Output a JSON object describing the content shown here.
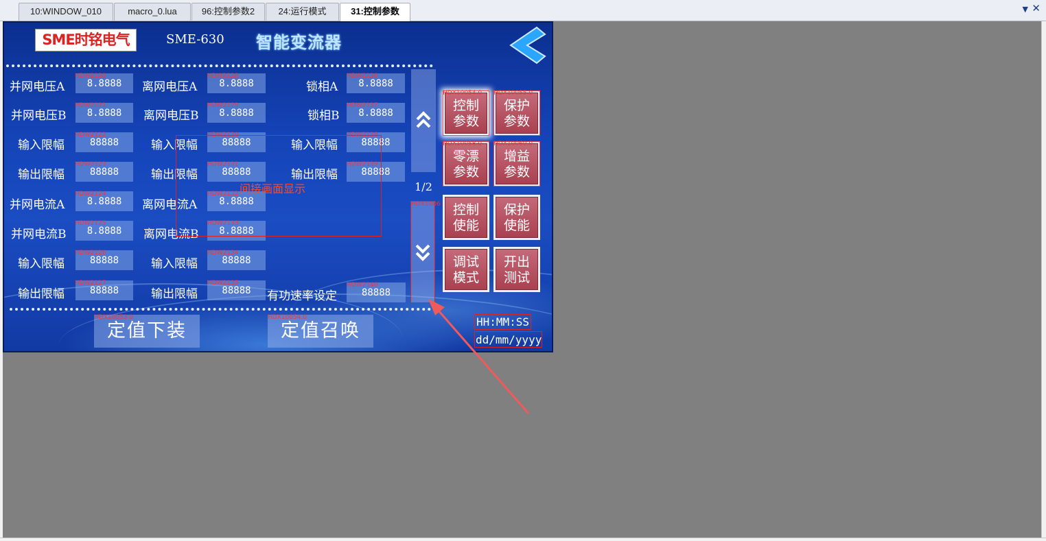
{
  "tabs": [
    {
      "label": "10:WINDOW_010"
    },
    {
      "label": "macro_0.lua"
    },
    {
      "label": "96:控制参数2"
    },
    {
      "label": "24:运行模式"
    },
    {
      "label": "31:控制参数"
    }
  ],
  "tab_menu_glyph": "▼",
  "tab_close_glyph": "✕",
  "header": {
    "logo_sme": "SME",
    "logo_cn": "时铭电气",
    "model": "SME-630",
    "product": "智能变流器"
  },
  "fields": [
    {
      "label": "并网电压A",
      "value": "8.8888",
      "tag": "HDW2120"
    },
    {
      "label": "离网电压A",
      "value": "8.8888",
      "tag": "HDW2128"
    },
    {
      "label": "锁相A",
      "value": "8.8888",
      "tag": "HDW2136"
    },
    {
      "label": "并网电压B",
      "value": "8.8888",
      "tag": "HDW2121"
    },
    {
      "label": "离网电压B",
      "value": "8.8888",
      "tag": "HDW2129"
    },
    {
      "label": "锁相B",
      "value": "8.8888",
      "tag": "HDW2137"
    },
    {
      "label": "输入限幅",
      "value": "88888",
      "tag": "HDW2122"
    },
    {
      "label": "输入限幅",
      "value": "88888",
      "tag": "HDW2130"
    },
    {
      "label": "输入限幅",
      "value": "88888",
      "tag": "HDW2138"
    },
    {
      "label": "输出限幅",
      "value": "88888",
      "tag": "HDW2123"
    },
    {
      "label": "输出限幅",
      "value": "88888",
      "tag": "HDW2131"
    },
    {
      "label": "输出限幅",
      "value": "88888",
      "tag": "HDW2139"
    },
    {
      "label": "并网电流A",
      "value": "8.8888",
      "tag": "HDW2124"
    },
    {
      "label": "离网电流A",
      "value": "8.8888",
      "tag": "HDW2132"
    },
    {
      "label": "并网电流B",
      "value": "8.8888",
      "tag": "HDW2125"
    },
    {
      "label": "离网电流B",
      "value": "8.8888",
      "tag": "HDW2133"
    },
    {
      "label": "输入限幅",
      "value": "88888",
      "tag": "HDW2126"
    },
    {
      "label": "输入限幅",
      "value": "88888",
      "tag": "HDW2134"
    },
    {
      "label": "输出限幅",
      "value": "88888",
      "tag": "HDW2127"
    },
    {
      "label": "输出限幅",
      "value": "88888",
      "tag": "HDW2135"
    },
    {
      "label": "有功速率设定",
      "value": "88888",
      "tag": "HDW2140"
    }
  ],
  "scroll": {
    "page": "1/2",
    "down_tag": "HDX1006"
  },
  "indirect_label": "间接画面显示",
  "side_buttons": [
    {
      "line1": "控制",
      "line2": "参数",
      "tag": "HDX10054.0"
    },
    {
      "line1": "保护",
      "line2": "参数",
      "tag": "HDX10055.0"
    },
    {
      "line1": "零漂",
      "line2": "参数",
      "tag": "HDX10058.0"
    },
    {
      "line1": "增益",
      "line2": "参数",
      "tag": "HDX10060.0"
    },
    {
      "line1": "控制",
      "line2": "使能",
      "tag": ""
    },
    {
      "line1": "保护",
      "line2": "使能",
      "tag": ""
    },
    {
      "line1": "调试",
      "line2": "模式",
      "tag": ""
    },
    {
      "line1": "开出",
      "line2": "测试",
      "tag": ""
    }
  ],
  "bottom_buttons": [
    {
      "label": "定值下装",
      "tag": "HDX10053.0"
    },
    {
      "label": "定值召唤",
      "tag": "HDX10054.0"
    }
  ],
  "clock": {
    "time": "HH:MM:SS",
    "date": "dd/mm/yyyy"
  },
  "colors": {
    "screen_bg": "#1544b8",
    "button_red": "#b04a58",
    "annotation_red": "#ff3030",
    "arrow": "#f05a5a"
  }
}
